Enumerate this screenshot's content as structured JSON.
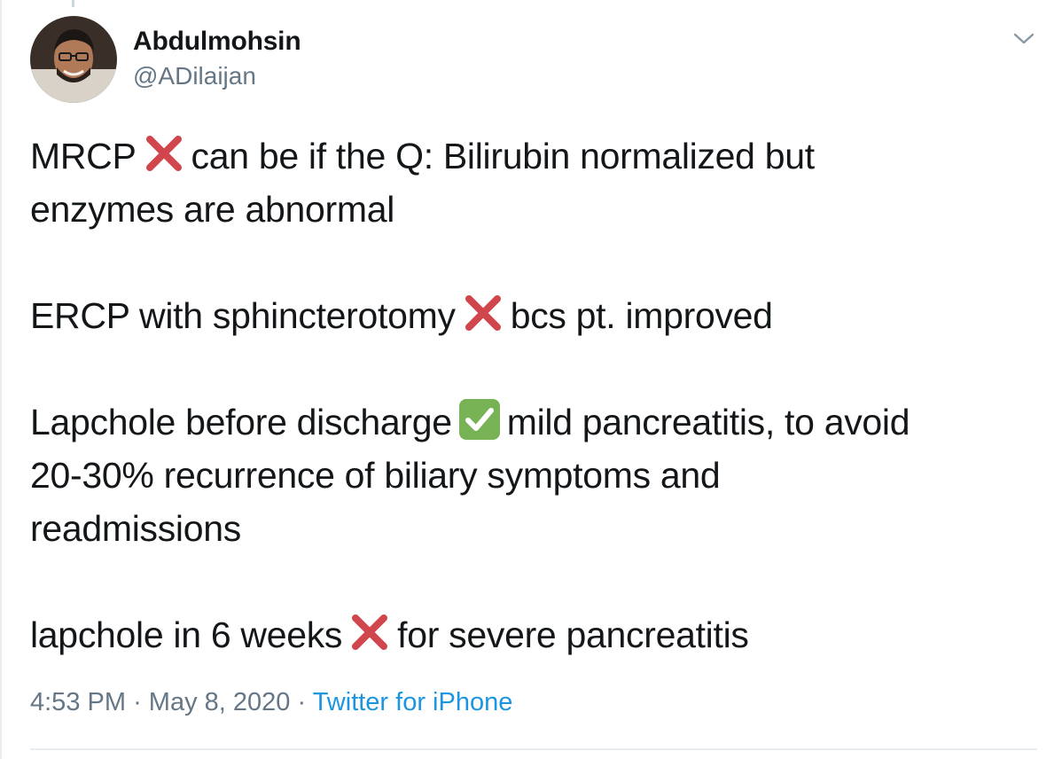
{
  "tweet": {
    "author": {
      "display_name": "Abdulmohsin",
      "handle": "@ADilaijan",
      "avatar_icon": "profile-photo"
    },
    "menu_icon": "chevron-down-icon",
    "body": {
      "line1_a": "MRCP",
      "line1_b": "can be  if the Q: Bilirubin normalized but",
      "line2": "enzymes are abnormal",
      "line3_a": "ERCP with sphincterotomy",
      "line3_b": "bcs pt. improved",
      "line4_a": "Lapchole before discharge",
      "line4_b": "mild pancreatitis, to avoid",
      "line5": "20-30% recurrence of biliary symptoms and",
      "line6": "readmissions",
      "line7_a": "lapchole in 6 weeks",
      "line7_b": "for severe pancreatitis"
    },
    "emojis": {
      "cross": "cross-mark-emoji",
      "check": "check-mark-button-emoji"
    },
    "time": "4:53 PM",
    "separator": "·",
    "date": "May 8, 2020",
    "source": "Twitter for iPhone"
  },
  "colors": {
    "text": "#14171a",
    "muted": "#657786",
    "link": "#1b95e0",
    "cross": "#d0464c",
    "check": "#77b255",
    "border": "#e6ecf0"
  }
}
